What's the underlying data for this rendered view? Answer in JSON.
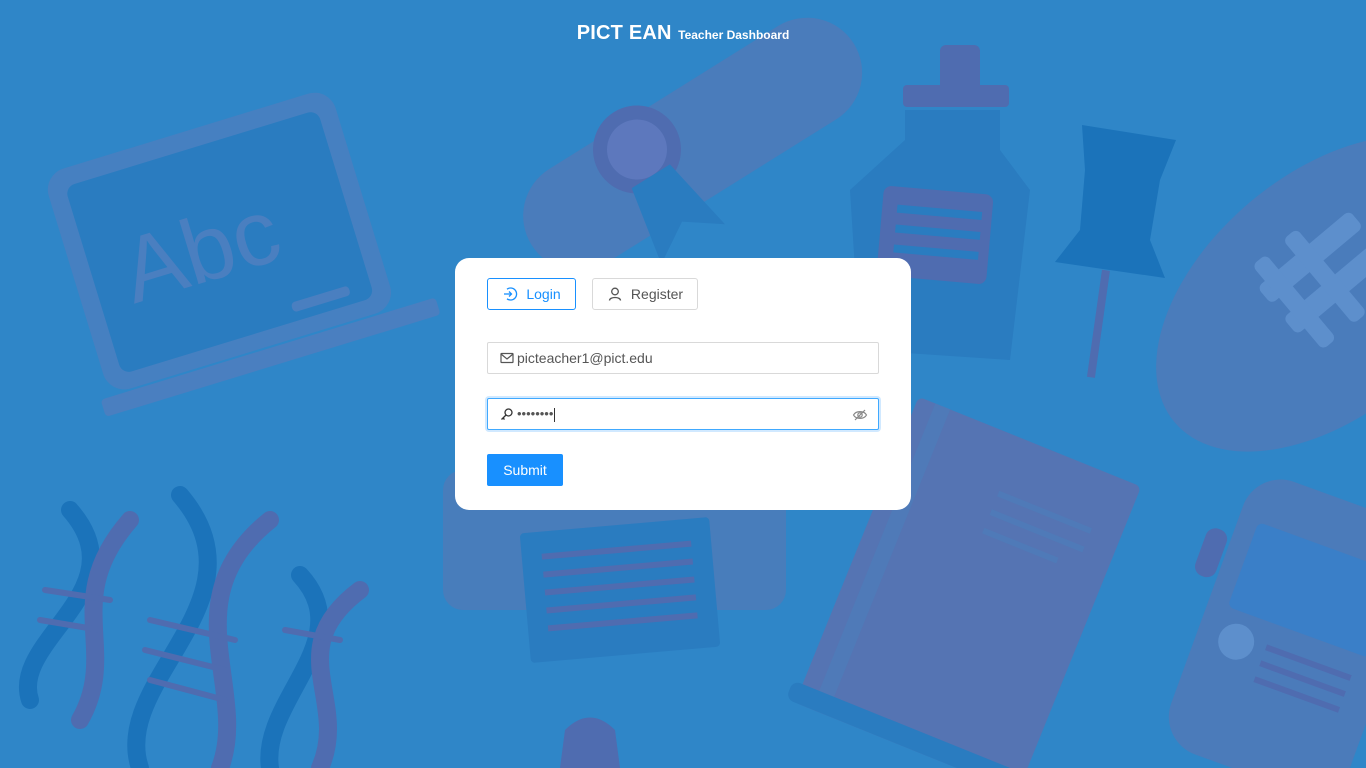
{
  "header": {
    "brand": "PICT EAN",
    "subtitle": "Teacher Dashboard"
  },
  "background": {
    "chalkboard_text": "Abc"
  },
  "tabs": [
    {
      "label": "Login",
      "icon": "login-icon",
      "active": true
    },
    {
      "label": "Register",
      "icon": "user-icon",
      "active": false
    }
  ],
  "form": {
    "email": {
      "value": "picteacher1@pict.edu",
      "icon": "mail-icon"
    },
    "password": {
      "value": "••••••••",
      "icon": "key-icon",
      "toggle_icon": "eye-invisible-icon"
    },
    "submit_label": "Submit"
  },
  "colors": {
    "background": "#2f86c8",
    "primary": "#1890ff",
    "card": "#ffffff"
  }
}
